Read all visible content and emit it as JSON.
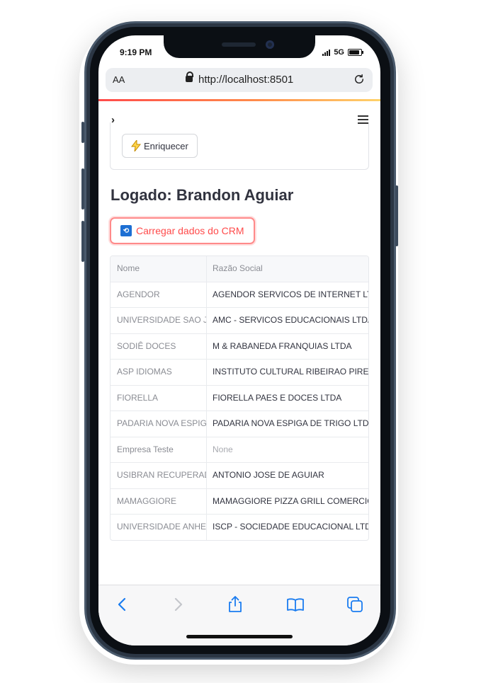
{
  "status": {
    "time": "9:19 PM",
    "network": "5G"
  },
  "browser": {
    "text_size": "AA",
    "url": "http://localhost:8501"
  },
  "app": {
    "enrich_button": "Enriquecer",
    "heading": "Logado: Brandon Aguiar",
    "load_button": "Carregar dados do CRM",
    "table": {
      "columns": [
        "Nome",
        "Razão Social"
      ],
      "rows": [
        [
          "AGENDOR",
          "AGENDOR SERVICOS DE INTERNET LTDA"
        ],
        [
          "UNIVERSIDADE SAO JUDAS",
          "AMC - SERVICOS EDUCACIONAIS LTDA"
        ],
        [
          "SODIÊ DOCES",
          "M & RABANEDA FRANQUIAS LTDA"
        ],
        [
          "ASP IDIOMAS",
          "INSTITUTO CULTURAL RIBEIRAO PIRES"
        ],
        [
          "FIORELLA",
          "FIORELLA PAES E DOCES LTDA"
        ],
        [
          "PADARIA NOVA ESPIGA",
          "PADARIA NOVA ESPIGA DE TRIGO LTDA"
        ],
        [
          "Empresa Teste",
          "None"
        ],
        [
          "USIBRAN RECUPERADORA",
          "ANTONIO JOSE DE AGUIAR"
        ],
        [
          "MAMAGGIORE",
          "MAMAGGIORE PIZZA GRILL COMERCIO"
        ],
        [
          "UNIVERSIDADE ANHEMBI",
          "ISCP - SOCIEDADE EDUCACIONAL LTDA"
        ]
      ]
    }
  },
  "colors": {
    "accent": "#ff4b4b",
    "ios_blue": "#1a7cf0"
  }
}
